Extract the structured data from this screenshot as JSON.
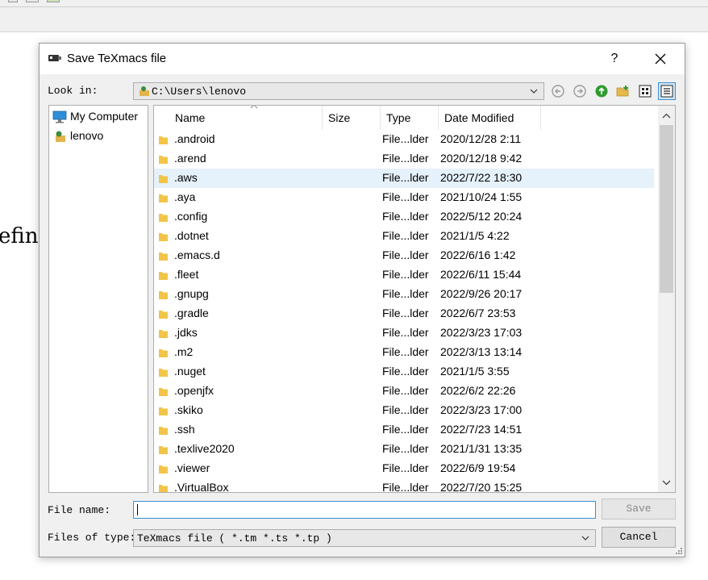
{
  "background": {
    "partial_text": "efin"
  },
  "dialog": {
    "title": "Save TeXmacs file",
    "help_label": "?",
    "look_in_label": "Look in:",
    "look_in_value": "C:\\Users\\lenovo",
    "toolbar_icons": [
      "back-icon",
      "forward-icon",
      "parent-dir-icon",
      "new-folder-icon",
      "list-view-icon",
      "detail-view-icon"
    ],
    "sidebar": [
      {
        "label": "My Computer",
        "icon": "computer-icon"
      },
      {
        "label": "lenovo",
        "icon": "user-folder-icon"
      }
    ],
    "columns": {
      "name": "Name",
      "size": "Size",
      "type": "Type",
      "date": "Date Modified"
    },
    "files": [
      {
        "name": ".android",
        "type": "File...lder",
        "date": "2020/12/28 2:11"
      },
      {
        "name": ".arend",
        "type": "File...lder",
        "date": "2020/12/18 9:42"
      },
      {
        "name": ".aws",
        "type": "File...lder",
        "date": "2022/7/22 18:30"
      },
      {
        "name": ".aya",
        "type": "File...lder",
        "date": "2021/10/24 1:55"
      },
      {
        "name": ".config",
        "type": "File...lder",
        "date": "2022/5/12 20:24"
      },
      {
        "name": ".dotnet",
        "type": "File...lder",
        "date": "2021/1/5 4:22"
      },
      {
        "name": ".emacs.d",
        "type": "File...lder",
        "date": "2022/6/16 1:42"
      },
      {
        "name": ".fleet",
        "type": "File...lder",
        "date": "2022/6/11 15:44"
      },
      {
        "name": ".gnupg",
        "type": "File...lder",
        "date": "2022/9/26 20:17"
      },
      {
        "name": ".gradle",
        "type": "File...lder",
        "date": "2022/6/7 23:53"
      },
      {
        "name": ".jdks",
        "type": "File...lder",
        "date": "2022/3/23 17:03"
      },
      {
        "name": ".m2",
        "type": "File...lder",
        "date": "2022/3/13 13:14"
      },
      {
        "name": ".nuget",
        "type": "File...lder",
        "date": "2021/1/5 3:55"
      },
      {
        "name": ".openjfx",
        "type": "File...lder",
        "date": "2022/6/2 22:26"
      },
      {
        "name": ".skiko",
        "type": "File...lder",
        "date": "2022/3/23 17:00"
      },
      {
        "name": ".ssh",
        "type": "File...lder",
        "date": "2022/7/23 14:51"
      },
      {
        "name": ".texlive2020",
        "type": "File...lder",
        "date": "2021/1/31 13:35"
      },
      {
        "name": ".viewer",
        "type": "File...lder",
        "date": "2022/6/9 19:54"
      },
      {
        "name": ".VirtualBox",
        "type": "File...lder",
        "date": "2022/7/20 15:25"
      }
    ],
    "hovered_file": ".aws",
    "file_name_label": "File name:",
    "file_name_value": "",
    "files_of_type_label": "Files of type:",
    "files_of_type_value": "TeXmacs file ( *.tm *.ts *.tp )",
    "save_label": "Save",
    "cancel_label": "Cancel",
    "colors": {
      "selection": "#e5f1fb",
      "focus": "#3c8fd6",
      "folder": "#f2c447"
    }
  }
}
